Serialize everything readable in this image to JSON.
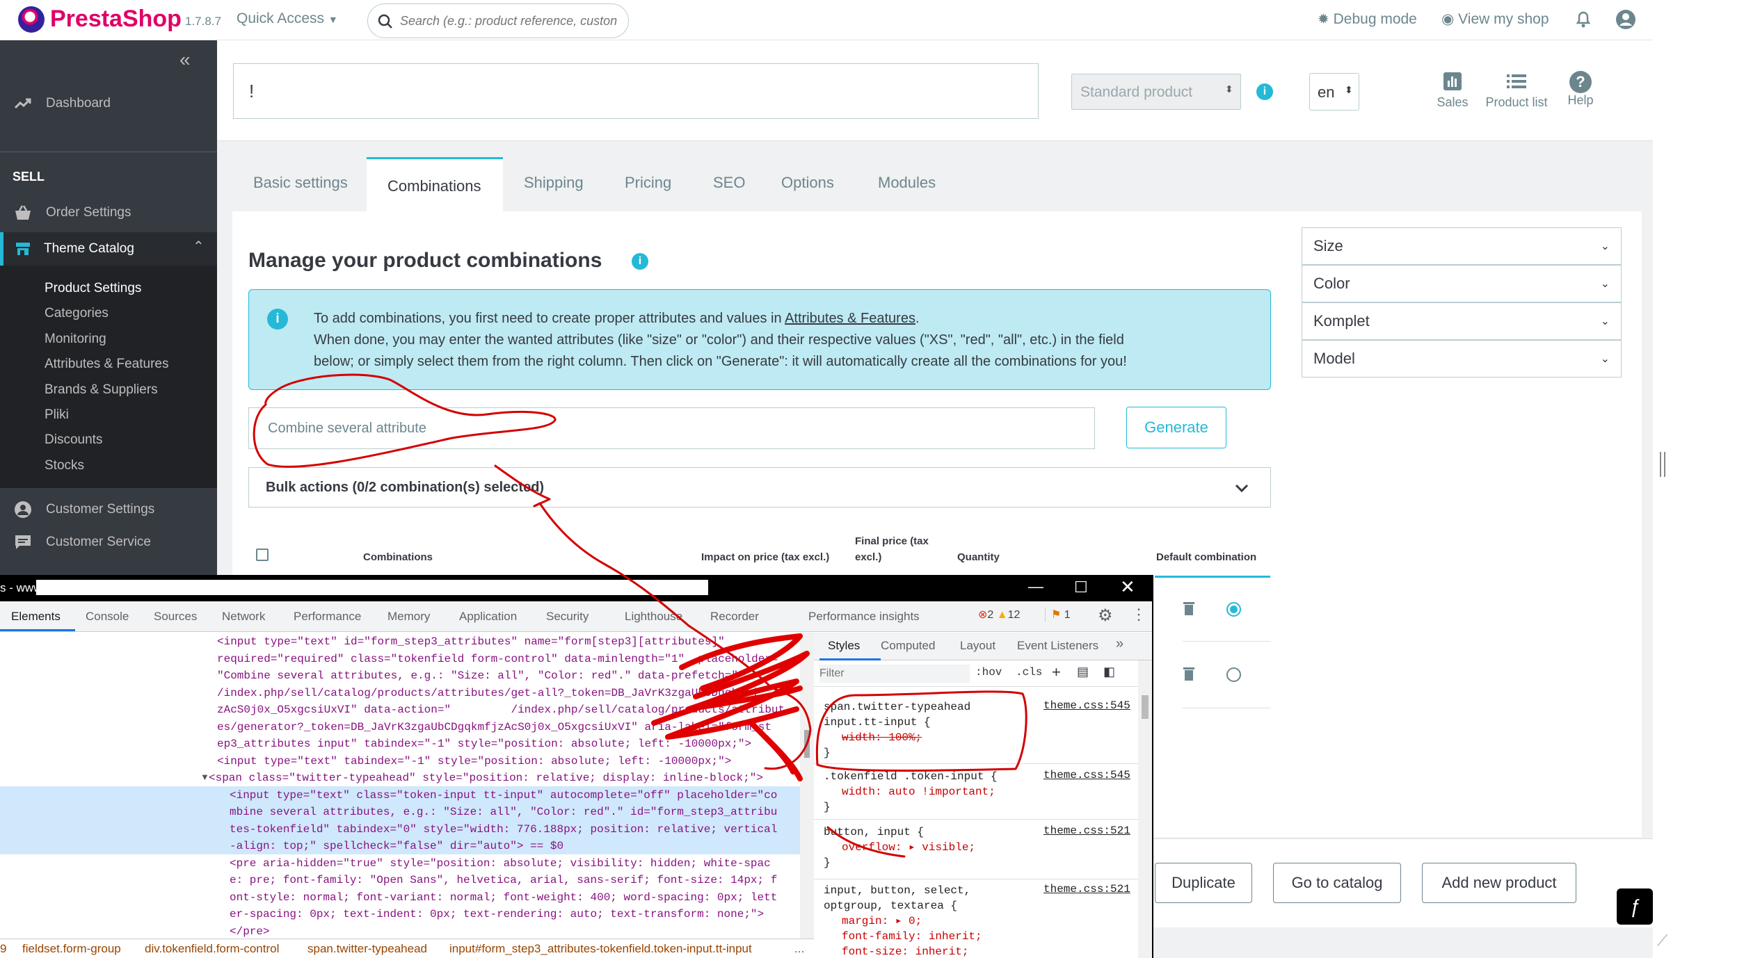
{
  "header": {
    "brand": "PrestaShop",
    "version": "1.7.8.7",
    "quick_access": "Quick Access",
    "search_placeholder": "Search (e.g.: product reference, custon",
    "debug": "Debug mode",
    "view_shop": "View my shop"
  },
  "sidebar": {
    "collapse": "«",
    "dashboard": "Dashboard",
    "sell": "SELL",
    "order_settings": "Order Settings",
    "theme_catalog": "Theme Catalog",
    "sub": [
      "Product Settings",
      "Categories",
      "Monitoring",
      "Attributes & Features",
      "Brands & Suppliers",
      "Pliki",
      "Discounts",
      "Stocks"
    ],
    "customer_settings": "Customer Settings",
    "customer_service": "Customer Service"
  },
  "product": {
    "name_value": "!",
    "type": "Standard product",
    "lang": "en"
  },
  "toolbar": {
    "sales": "Sales",
    "product_list": "Product list",
    "help": "Help"
  },
  "tabs": [
    "Basic settings",
    "Combinations",
    "Shipping",
    "Pricing",
    "SEO",
    "Options",
    "Modules"
  ],
  "combinations": {
    "title": "Manage your product combinations",
    "alert_pre": "To add combinations, you first need to create proper attributes and values in ",
    "alert_link": "Attributes & Features",
    "alert_post": ".",
    "alert_line2": "When done, you may enter the wanted attributes (like \"size\" or \"color\") and their respective values (\"XS\", \"red\", \"all\", etc.) in the field",
    "alert_line3": "below; or simply select them from the right column. Then click on \"Generate\": it will automatically create all the combinations for you!",
    "input_placeholder": "Combine several attribute",
    "generate": "Generate",
    "bulk": "Bulk actions (0/2 combination(s) selected)",
    "col_combinations": "Combinations",
    "col_impact": "Impact on price (tax excl.)",
    "col_final": "Final price (tax",
    "col_final2": "excl.)",
    "col_qty": "Quantity",
    "col_default": "Default combination"
  },
  "attributes": [
    "Size",
    "Color",
    "Komplet",
    "Model"
  ],
  "footer_buttons": {
    "duplicate": "Duplicate",
    "catalog": "Go to catalog",
    "add_new": "Add new product"
  },
  "devtools": {
    "title_prefix": "s - www",
    "tabs": [
      "Elements",
      "Console",
      "Sources",
      "Network",
      "Performance",
      "Memory",
      "Application",
      "Security",
      "Lighthouse",
      "Recorder",
      "Performance insights"
    ],
    "errors": "2",
    "warnings": "12",
    "issues": "1",
    "code_lines": [
      "<input type=\"text\" id=\"form_step3_attributes\" name=\"form[step3][attributes]\"",
      "required=\"required\" class=\"tokenfield form-control\" data-minlength=\"1\"  placeholder=",
      "\"Combine several attributes, e.g.: \"Size: all\", \"Color: red\".\" data-prefetch=\"",
      " /index.php/sell/catalog/products/attributes/get-all?_token=DB_JaVrK3zgaUbCDgqkmfj",
      "zAcS0j0x_O5xgcsiUxVI\" data-action=\"         /index.php/sell/catalog/products/attribut",
      "es/generator?_token=DB_JaVrK3zgaUbCDgqkmfjzAcS0j0x_O5xgcsiUxVI\" aria-label=\"form_st",
      "ep3_attributes input\" tabindex=\"-1\" style=\"position: absolute; left: -10000px;\">",
      "<input type=\"text\" tabindex=\"-1\" style=\"position: absolute; left: -10000px;\">",
      "<span class=\"twitter-typeahead\" style=\"position: relative; display: inline-block;\">",
      "  <input type=\"text\" class=\"token-input tt-input\" autocomplete=\"off\" placeholder=\"co",
      "  mbine several attributes, e.g.: \"Size: all\", \"Color: red\".\" id=\"form_step3_attribu",
      "  tes-tokenfield\" tabindex=\"0\" style=\"width: 776.188px; position: relative; vertical",
      "  -align: top;\" spellcheck=\"false\" dir=\"auto\"> == $0",
      "  <pre aria-hidden=\"true\" style=\"position: absolute; visibility: hidden; white-spac",
      "  e: pre; font-family: \"Open Sans\", helvetica, arial, sans-serif; font-size: 14px; f",
      "  ont-style: normal; font-variant: normal; font-weight: 400; word-spacing: 0px; lett",
      "  er-spacing: 0px; text-indent: 0px; text-rendering: auto; text-transform: none;\">",
      "  </pre>"
    ],
    "styles_tabs": [
      "Styles",
      "Computed",
      "Layout",
      "Event Listeners"
    ],
    "filter_placeholder": "Filter",
    "hov": ":hov",
    "cls": ".cls",
    "rules": [
      {
        "selector": "span.twitter-typeahead",
        "selector2": "input.tt-input {",
        "src": "theme.css:545",
        "decls": [
          "width: 100%;"
        ]
      },
      {
        "selector": ".tokenfield .token-input {",
        "selector2": "",
        "src": "theme.css:545",
        "decls": [
          "width: auto !important;"
        ]
      },
      {
        "selector": "button, input {",
        "selector2": "",
        "src": "theme.css:521",
        "decls": [
          "overflow: ▸ visible;"
        ]
      },
      {
        "selector": "input, button, select,",
        "selector2": "optgroup, textarea {",
        "src": "theme.css:521",
        "decls": [
          "margin: ▸ 0;",
          "font-family: inherit;",
          "font-size: inherit;"
        ]
      }
    ],
    "crumbs": [
      "9",
      "fieldset.form-group",
      "div.tokenfield.form-control",
      "span.twitter-typeahead",
      "input#form_step3_attributes-tokenfield.token-input.tt-input",
      "..."
    ]
  }
}
